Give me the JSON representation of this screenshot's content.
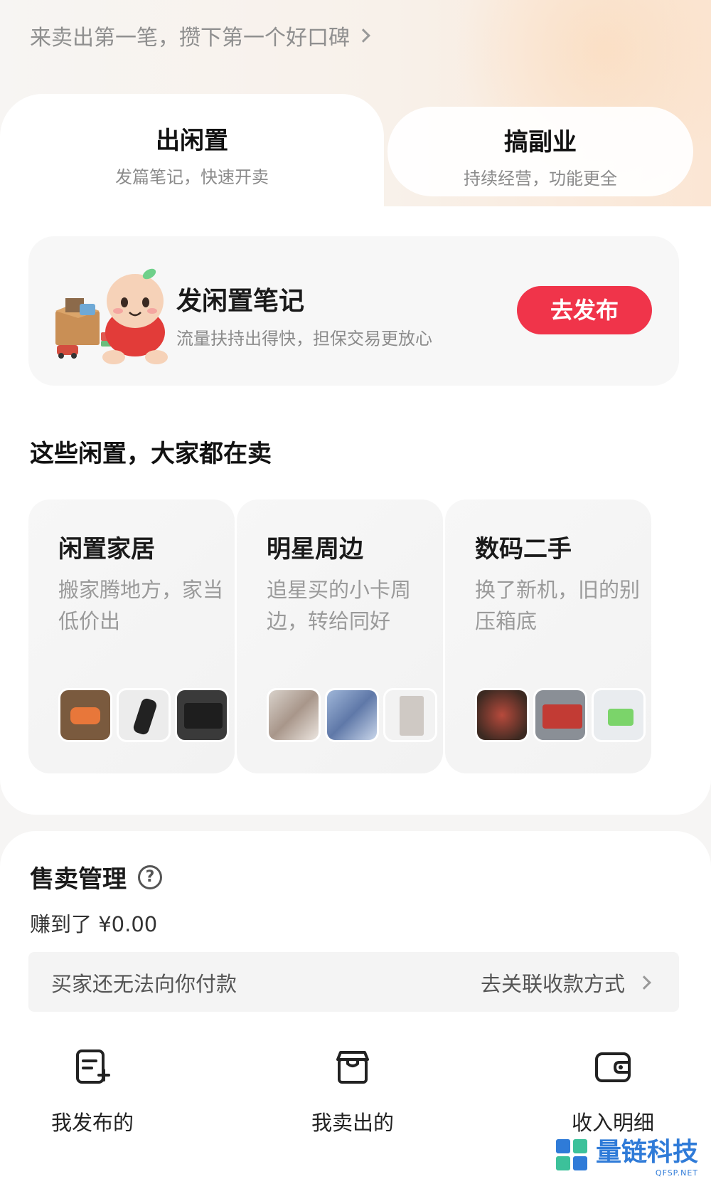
{
  "header": {
    "tagline": "来卖出第一笔，攒下第一个好口碑"
  },
  "tabs": [
    {
      "title": "出闲置",
      "subtitle": "发篇笔记，快速开卖"
    },
    {
      "title": "搞副业",
      "subtitle": "持续经营，功能更全"
    }
  ],
  "publish_card": {
    "title": "发闲置笔记",
    "subtitle": "流量扶持出得快，担保交易更放心",
    "button": "去发布"
  },
  "section": {
    "title": "这些闲置，大家都在卖"
  },
  "categories": [
    {
      "name": "闲置家居",
      "desc": "搬家腾地方，家当低价出"
    },
    {
      "name": "明星周边",
      "desc": "追星买的小卡周边，转给同好"
    },
    {
      "name": "数码二手",
      "desc": "换了新机，旧的别压箱底"
    }
  ],
  "sales": {
    "title": "售卖管理",
    "earned": "赚到了 ¥0.00",
    "payment_warning": "买家还无法向你付款",
    "payment_link": "去关联收款方式"
  },
  "actions": [
    {
      "label": "我发布的",
      "icon": "edit-doc-icon"
    },
    {
      "label": "我卖出的",
      "icon": "box-icon"
    },
    {
      "label": "收入明细",
      "icon": "wallet-icon"
    }
  ],
  "watermark": {
    "text": "量链科技",
    "sub": "QFSP.NET"
  },
  "colors": {
    "accent": "#f0344a",
    "watermark": "#2f7bd8"
  }
}
